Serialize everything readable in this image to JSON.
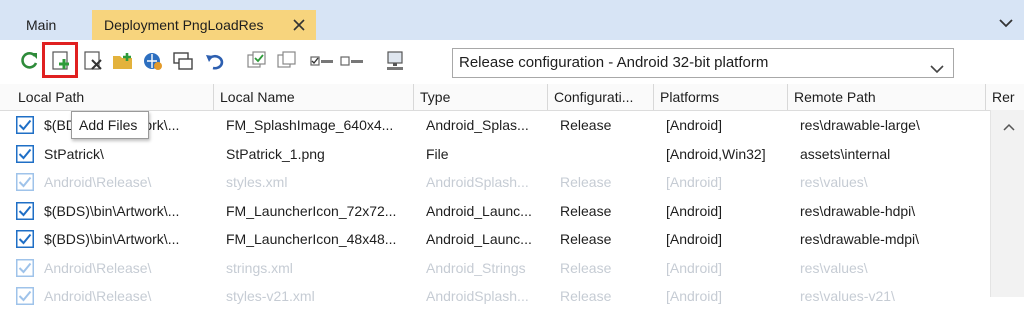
{
  "tabs": {
    "main_label": "Main",
    "active_label": "Deployment PngLoadRes"
  },
  "toolbar": {
    "buttons": [
      {
        "name": "refresh-icon"
      },
      {
        "name": "add-files-icon"
      },
      {
        "name": "remove-files-icon"
      },
      {
        "name": "add-folder-icon"
      },
      {
        "name": "connect-icon"
      },
      {
        "name": "deploy-icon"
      },
      {
        "name": "revert-icon"
      },
      {
        "name": "check-selected-icon"
      },
      {
        "name": "copy-icon"
      },
      {
        "name": "check-all-icon"
      },
      {
        "name": "uncheck-all-icon"
      },
      {
        "name": "computer-icon"
      }
    ],
    "config_value": "Release configuration - Android 32-bit platform",
    "tooltip": "Add Files"
  },
  "columns": [
    "Local Path",
    "Local Name",
    "Type",
    "Configurati...",
    "Platforms",
    "Remote Path",
    "Rer"
  ],
  "rows": [
    {
      "checked": true,
      "disabled": false,
      "local_path": "$(BDS)\\bin\\Artwork\\...",
      "local_name": "FM_SplashImage_640x4...",
      "type": "Android_Splas...",
      "config": "Release",
      "platforms": "[Android]",
      "remote_path": "res\\drawable-large\\"
    },
    {
      "checked": true,
      "disabled": false,
      "local_path": "StPatrick\\",
      "local_name": "StPatrick_1.png",
      "type": "File",
      "config": "",
      "platforms": "[Android,Win32]",
      "remote_path": "assets\\internal"
    },
    {
      "checked": true,
      "disabled": true,
      "local_path": "Android\\Release\\",
      "local_name": "styles.xml",
      "type": "AndroidSplash...",
      "config": "Release",
      "platforms": "[Android]",
      "remote_path": "res\\values\\"
    },
    {
      "checked": true,
      "disabled": false,
      "local_path": "$(BDS)\\bin\\Artwork\\...",
      "local_name": "FM_LauncherIcon_72x72...",
      "type": "Android_Launc...",
      "config": "Release",
      "platforms": "[Android]",
      "remote_path": "res\\drawable-hdpi\\"
    },
    {
      "checked": true,
      "disabled": false,
      "local_path": "$(BDS)\\bin\\Artwork\\...",
      "local_name": "FM_LauncherIcon_48x48...",
      "type": "Android_Launc...",
      "config": "Release",
      "platforms": "[Android]",
      "remote_path": "res\\drawable-mdpi\\"
    },
    {
      "checked": true,
      "disabled": true,
      "local_path": "Android\\Release\\",
      "local_name": "strings.xml",
      "type": "Android_Strings",
      "config": "Release",
      "platforms": "[Android]",
      "remote_path": "res\\values\\"
    },
    {
      "checked": true,
      "disabled": true,
      "local_path": "Android\\Release\\",
      "local_name": "styles-v21.xml",
      "type": "AndroidSplash...",
      "config": "Release",
      "platforms": "[Android]",
      "remote_path": "res\\values-v21\\"
    }
  ],
  "colors": {
    "tab_strip": "#d7e4f5",
    "active_tab": "#f7d47d",
    "highlight": "#e02020",
    "checkbox": "#1f6fc6",
    "disabled_text": "#c6ccd4"
  }
}
